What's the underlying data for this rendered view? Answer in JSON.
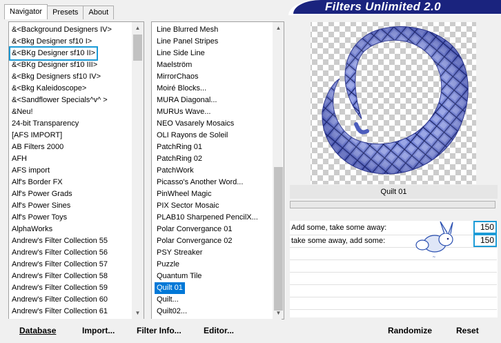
{
  "tabs": [
    "Navigator",
    "Presets",
    "About"
  ],
  "banner_title": "Filters Unlimited 2.0",
  "categories": [
    "&<Background Designers IV>",
    "&<Bkg Designer sf10 I>",
    "&<BKg Designer sf10 II>",
    "&<BKg Designer sf10 III>",
    "&<Bkg Designers sf10 IV>",
    "&<Bkg Kaleidoscope>",
    "&<Sandflower Specials^v^ >",
    "&Neu!",
    "24-bit Transparency",
    "[AFS IMPORT]",
    "AB Filters 2000",
    "AFH",
    "AFS import",
    "Alf's Border FX",
    "Alf's Power Grads",
    "Alf's Power Sines",
    "Alf's Power Toys",
    "AlphaWorks",
    "Andrew's Filter Collection 55",
    "Andrew's Filter Collection 56",
    "Andrew's Filter Collection 57",
    "Andrew's Filter Collection 58",
    "Andrew's Filter Collection 59",
    "Andrew's Filter Collection 60",
    "Andrew's Filter Collection 61"
  ],
  "selected_category": "&<BKg Designer sf10 II>",
  "filters": [
    "Line Blurred Mesh",
    "Line Panel Stripes",
    "Line Side Line",
    "Maelström",
    "MirrorChaos",
    "Moiré Blocks...",
    "MURA Diagonal...",
    "MURUs Wave...",
    "NEO Vasarely Mosaics",
    "OLI Rayons de Soleil",
    "PatchRing 01",
    "PatchRing 02",
    "PatchWork",
    "Picasso's Another Word...",
    "PinWheel Magic",
    "PIX Sector Mosaic",
    "PLAB10 Sharpened PencilX...",
    "Polar Convergance 01",
    "Polar Convergance 02",
    "PSY Streaker",
    "Puzzle",
    "Quantum Tile",
    "Quilt 01",
    "Quilt...",
    "Quilt02..."
  ],
  "selected_filter": "Quilt 01",
  "preview_caption": "Quilt 01",
  "params": [
    {
      "label": "Add some, take some away:",
      "value": "150"
    },
    {
      "label": "take some away, add some:",
      "value": "150"
    }
  ],
  "buttons": {
    "database": "Database",
    "import": "Import...",
    "filter_info": "Filter Info...",
    "editor": "Editor...",
    "randomize": "Randomize",
    "reset": "Reset"
  },
  "colors": {
    "selection": "#0078d7",
    "highlight_box": "#1b9bd7",
    "banner": "#1a237e",
    "quilt": "#4a5ab8"
  }
}
